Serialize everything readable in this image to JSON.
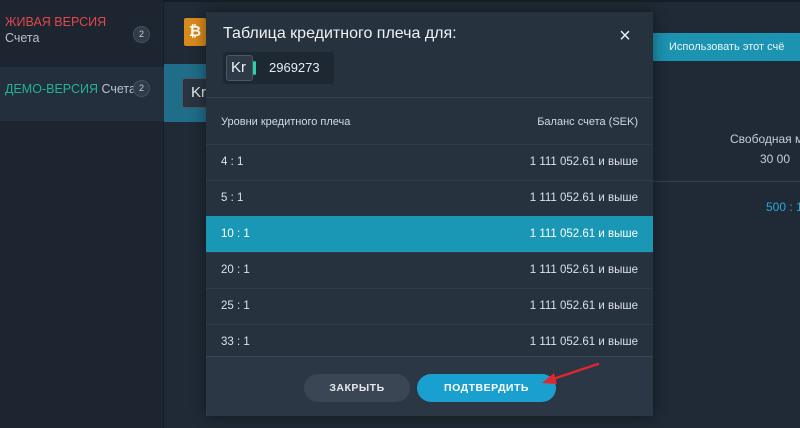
{
  "sidebar": {
    "live": {
      "label": "ЖИВАЯ ВЕРСИЯ",
      "sub": "Счета",
      "count": "2"
    },
    "demo": {
      "label": "ДЕМО-ВЕРСИЯ",
      "sub": "Счета",
      "count": "2"
    }
  },
  "background": {
    "use_button": "Использовать этот счё",
    "free_margin_label": "Свободная м",
    "free_margin_value": "30 00",
    "blue_value": "500 : 1",
    "kr_text": "Kr",
    "btc_icon": "bitcoin-icon"
  },
  "modal": {
    "title": "Таблица кредитного плеча для:",
    "account_icon_text": "Kr",
    "account_number": "2969273",
    "table": {
      "col_leverage": "Уровни кредитного плеча",
      "col_balance": "Баланс счета (SEK)",
      "rows": [
        {
          "leverage": "4 : 1",
          "balance": "1 111 052.61 и выше"
        },
        {
          "leverage": "5 : 1",
          "balance": "1 111 052.61 и выше"
        },
        {
          "leverage": "10 : 1",
          "balance": "1 111 052.61 и выше"
        },
        {
          "leverage": "20 : 1",
          "balance": "1 111 052.61 и выше"
        },
        {
          "leverage": "25 : 1",
          "balance": "1 111 052.61 и выше"
        },
        {
          "leverage": "33 : 1",
          "balance": "1 111 052.61 и выше"
        }
      ],
      "selected_leverage": "10 : 1"
    },
    "close_label": "ЗАКРЫТЬ",
    "confirm_label": "ПОДТВЕРДИТЬ"
  },
  "colors": {
    "accent": "#1a97b4",
    "live_red": "#e2474c",
    "demo_green": "#21b493",
    "arrow_red": "#e0262f"
  }
}
